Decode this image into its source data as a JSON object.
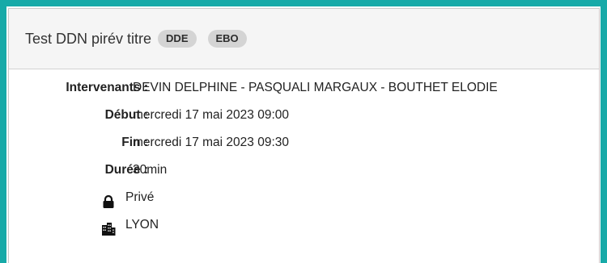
{
  "event": {
    "title": "Test DDN pirév titre",
    "badges": [
      "DDE",
      "EBO"
    ]
  },
  "details": {
    "participants_label": "Intervenants :",
    "participants_value": "DEVIN DELPHINE - PASQUALI MARGAUX - BOUTHET ELODIE",
    "start_label": "Début :",
    "start_value": "mercredi 17 mai 2023 09:00",
    "end_label": "Fin :",
    "end_value": "mercredi 17 mai 2023 09:30",
    "duration_label": "Durée :",
    "duration_value": "30min",
    "privacy_icon": "lock-icon",
    "privacy_text": "Privé",
    "location_icon": "building-icon",
    "location_text": "LYON"
  },
  "colors": {
    "frame_border": "#17aaa8",
    "header_bg": "#f5f5f5",
    "badge_bg": "#d4d4d4"
  }
}
